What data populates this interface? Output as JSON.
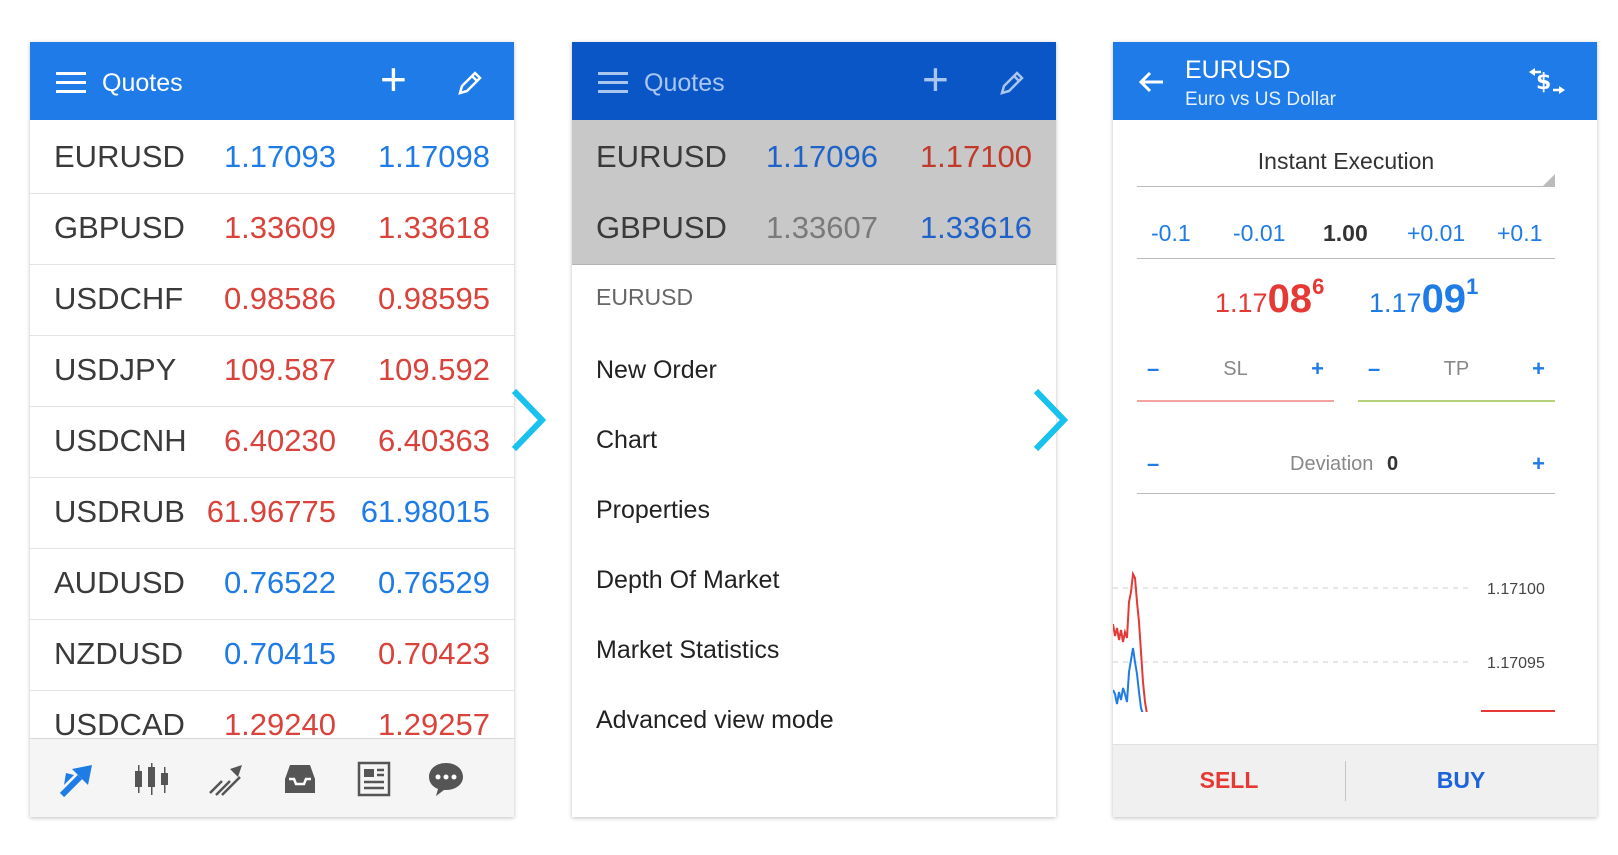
{
  "colors": {
    "header_blue": "#1e7be8",
    "header_dark": "#0b56c6",
    "up_blue": "#1f7be6",
    "down_red": "#d9433b",
    "accent_cyan": "#18c2ee"
  },
  "quotes_screen": {
    "title": "Quotes",
    "rows": [
      {
        "symbol": "EURUSD",
        "bid": "1.17093",
        "ask": "1.17098",
        "bid_color": "blue",
        "ask_color": "blue"
      },
      {
        "symbol": "GBPUSD",
        "bid": "1.33609",
        "ask": "1.33618",
        "bid_color": "red",
        "ask_color": "red"
      },
      {
        "symbol": "USDCHF",
        "bid": "0.98586",
        "ask": "0.98595",
        "bid_color": "red",
        "ask_color": "red"
      },
      {
        "symbol": "USDJPY",
        "bid": "109.587",
        "ask": "109.592",
        "bid_color": "red",
        "ask_color": "red"
      },
      {
        "symbol": "USDCNH",
        "bid": "6.40230",
        "ask": "6.40363",
        "bid_color": "red",
        "ask_color": "red"
      },
      {
        "symbol": "USDRUB",
        "bid": "61.96775",
        "ask": "61.98015",
        "bid_color": "red",
        "ask_color": "blue"
      },
      {
        "symbol": "AUDUSD",
        "bid": "0.76522",
        "ask": "0.76529",
        "bid_color": "blue",
        "ask_color": "blue"
      },
      {
        "symbol": "NZDUSD",
        "bid": "0.70415",
        "ask": "0.70423",
        "bid_color": "blue",
        "ask_color": "red"
      },
      {
        "symbol": "USDCAD",
        "bid": "1.29240",
        "ask": "1.29257",
        "bid_color": "red",
        "ask_color": "red"
      }
    ],
    "toolbar_icons": [
      "quotes-icon",
      "chart-icon",
      "trade-icon",
      "history-icon",
      "news-icon",
      "chat-icon"
    ]
  },
  "context_screen": {
    "title": "Quotes",
    "rows": [
      {
        "symbol": "EURUSD",
        "bid": "1.17096",
        "ask": "1.17100"
      },
      {
        "symbol": "GBPUSD",
        "bid": "1.33607",
        "ask": "1.33616"
      }
    ],
    "menu_header": "EURUSD",
    "menu_items": [
      "New Order",
      "Chart",
      "Properties",
      "Depth Of Market",
      "Market Statistics",
      "Advanced view mode"
    ]
  },
  "order_screen": {
    "symbol": "EURUSD",
    "description": "Euro vs US Dollar",
    "execution": "Instant Execution",
    "volume_steps": [
      "-0.1",
      "-0.01",
      "1.00",
      "+0.01",
      "+0.1"
    ],
    "sell_price": {
      "small": "1.17",
      "big": "08",
      "sup": "6"
    },
    "buy_price": {
      "small": "1.17",
      "big": "09",
      "sup": "1"
    },
    "sl_label": "SL",
    "tp_label": "TP",
    "minus": "–",
    "plus": "+",
    "deviation_label": "Deviation",
    "deviation_value": "0",
    "chart_levels": [
      "1.17100",
      "1.17095"
    ],
    "sell_label": "SELL",
    "buy_label": "BUY"
  }
}
